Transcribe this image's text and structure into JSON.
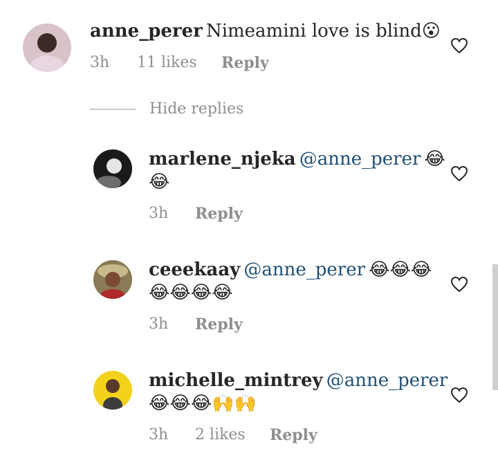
{
  "comments": [
    {
      "username": "anne_perer",
      "text": "Nimeamini love is blind",
      "emoji": "😮",
      "time": "3h",
      "likes": "11 likes",
      "reply_label": "Reply"
    }
  ],
  "hide_replies_label": "Hide replies",
  "replies": [
    {
      "username": "marlene_njeka",
      "mention": "@anne_perer",
      "emoji_line1": "😂",
      "emoji_line2": "😂",
      "time": "3h",
      "reply_label": "Reply"
    },
    {
      "username": "ceeekaay",
      "mention": "@anne_perer",
      "emoji_line1": "😂😂😂",
      "emoji_line2": "😂😂😂😂",
      "time": "3h",
      "reply_label": "Reply"
    },
    {
      "username": "michelle_mintrey",
      "mention": "@anne_perer",
      "emoji_line2": "😂😂😂🙌🙌",
      "time": "3h",
      "likes": "2 likes",
      "reply_label": "Reply"
    }
  ],
  "icons": {
    "like": "heart-outline-icon"
  },
  "colors": {
    "mention": "#1f4e79",
    "meta": "#8e8e8e"
  }
}
